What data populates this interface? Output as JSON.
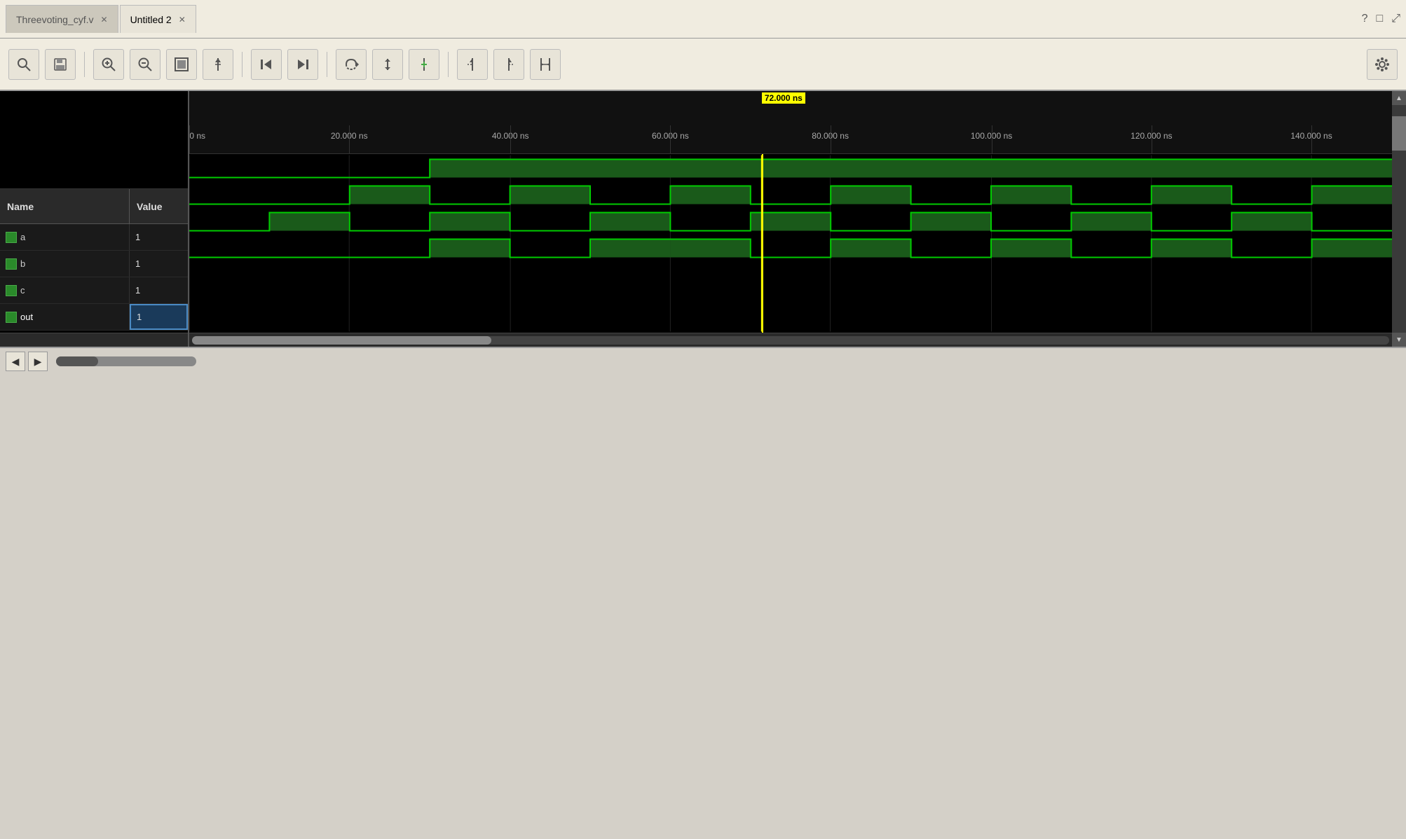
{
  "tabs": [
    {
      "label": "Threevoting_cyf.v",
      "active": false,
      "closeable": true
    },
    {
      "label": "Untitled 2",
      "active": true,
      "closeable": true
    }
  ],
  "title_bar_right": [
    "?",
    "□",
    "⤢"
  ],
  "toolbar": {
    "buttons": [
      {
        "name": "search",
        "icon": "🔍"
      },
      {
        "name": "save",
        "icon": "💾"
      },
      {
        "name": "zoom-in",
        "icon": "🔍+"
      },
      {
        "name": "zoom-out",
        "icon": "🔍-"
      },
      {
        "name": "fit",
        "icon": "⊡"
      },
      {
        "name": "cursor",
        "icon": "⇥"
      },
      {
        "name": "prev-edge",
        "icon": "⏮"
      },
      {
        "name": "next-edge",
        "icon": "⏭"
      },
      {
        "name": "cycle1",
        "icon": "↔"
      },
      {
        "name": "cycle2",
        "icon": "↕"
      },
      {
        "name": "add-marker",
        "icon": "⁺↕"
      },
      {
        "name": "marker1",
        "icon": "▶|"
      },
      {
        "name": "marker2",
        "icon": "|◀"
      },
      {
        "name": "marker3",
        "icon": "|↔|"
      }
    ],
    "settings_icon": "⚙"
  },
  "panel": {
    "col_name": "Name",
    "col_value": "Value",
    "signals": [
      {
        "name": "a",
        "value": "1",
        "selected": false
      },
      {
        "name": "b",
        "value": "1",
        "selected": false
      },
      {
        "name": "c",
        "value": "1",
        "selected": false
      },
      {
        "name": "out",
        "value": "1",
        "selected": true
      }
    ]
  },
  "waveform": {
    "cursor_time": "72.000 ns",
    "cursor_left_pct": 47.6,
    "time_labels": [
      {
        "label": "0.000 ns",
        "pct": 0
      },
      {
        "label": "20.000 ns",
        "pct": 13.3
      },
      {
        "label": "40.000 ns",
        "pct": 26.7
      },
      {
        "label": "60.000 ns",
        "pct": 40.0
      },
      {
        "label": "80.000 ns",
        "pct": 53.3
      },
      {
        "label": "100.000 ns",
        "pct": 66.7
      },
      {
        "label": "120.000 ns",
        "pct": 80.0
      },
      {
        "label": "140.000 ns",
        "pct": 93.3
      }
    ],
    "signals": [
      {
        "name": "a",
        "segments": [
          {
            "start": 0,
            "end": 30.0,
            "val": 0
          },
          {
            "start": 30.0,
            "end": 150,
            "val": 1
          }
        ]
      },
      {
        "name": "b",
        "segments": [
          {
            "start": 0,
            "end": 20.0,
            "val": 0
          },
          {
            "start": 20.0,
            "end": 30.0,
            "val": 1
          },
          {
            "start": 30.0,
            "end": 40.0,
            "val": 0
          },
          {
            "start": 40.0,
            "end": 50.0,
            "val": 1
          },
          {
            "start": 50.0,
            "end": 60.0,
            "val": 0
          },
          {
            "start": 60.0,
            "end": 70.0,
            "val": 1
          },
          {
            "start": 70.0,
            "end": 80.0,
            "val": 0
          },
          {
            "start": 80.0,
            "end": 90.0,
            "val": 1
          },
          {
            "start": 90.0,
            "end": 100.0,
            "val": 0
          },
          {
            "start": 100.0,
            "end": 110.0,
            "val": 1
          },
          {
            "start": 110.0,
            "end": 120.0,
            "val": 0
          },
          {
            "start": 120.0,
            "end": 130.0,
            "val": 1
          },
          {
            "start": 130.0,
            "end": 140.0,
            "val": 0
          },
          {
            "start": 140.0,
            "end": 150,
            "val": 1
          }
        ]
      },
      {
        "name": "c",
        "segments": [
          {
            "start": 0,
            "end": 10.0,
            "val": 0
          },
          {
            "start": 10.0,
            "end": 20.0,
            "val": 1
          },
          {
            "start": 20.0,
            "end": 30.0,
            "val": 0
          },
          {
            "start": 30.0,
            "end": 40.0,
            "val": 1
          },
          {
            "start": 40.0,
            "end": 50.0,
            "val": 0
          },
          {
            "start": 50.0,
            "end": 60.0,
            "val": 1
          },
          {
            "start": 60.0,
            "end": 70.0,
            "val": 0
          },
          {
            "start": 70.0,
            "end": 80.0,
            "val": 1
          },
          {
            "start": 80.0,
            "end": 90.0,
            "val": 0
          },
          {
            "start": 90.0,
            "end": 100.0,
            "val": 1
          },
          {
            "start": 100.0,
            "end": 110.0,
            "val": 0
          },
          {
            "start": 110.0,
            "end": 120.0,
            "val": 1
          },
          {
            "start": 120.0,
            "end": 130.0,
            "val": 0
          },
          {
            "start": 130.0,
            "end": 140.0,
            "val": 1
          },
          {
            "start": 140.0,
            "end": 150,
            "val": 0
          }
        ]
      },
      {
        "name": "out",
        "segments": [
          {
            "start": 0,
            "end": 20.0,
            "val": 0
          },
          {
            "start": 20.0,
            "end": 30.0,
            "val": 0
          },
          {
            "start": 30.0,
            "end": 40.0,
            "val": 1
          },
          {
            "start": 40.0,
            "end": 50.0,
            "val": 0
          },
          {
            "start": 50.0,
            "end": 60.0,
            "val": 1
          },
          {
            "start": 60.0,
            "end": 70.0,
            "val": 1
          },
          {
            "start": 70.0,
            "end": 80.0,
            "val": 0
          },
          {
            "start": 80.0,
            "end": 90.0,
            "val": 1
          },
          {
            "start": 90.0,
            "end": 100.0,
            "val": 0
          },
          {
            "start": 100.0,
            "end": 110.0,
            "val": 1
          },
          {
            "start": 110.0,
            "end": 120.0,
            "val": 0
          },
          {
            "start": 120.0,
            "end": 130.0,
            "val": 1
          },
          {
            "start": 130.0,
            "end": 140.0,
            "val": 0
          },
          {
            "start": 140.0,
            "end": 150,
            "val": 1
          }
        ]
      }
    ]
  },
  "scrollbar": {
    "h_thumb_pct": 25,
    "h_thumb_left": 0
  },
  "bottom_nav": {
    "left_arrow": "◀",
    "right_arrow": "▶"
  }
}
